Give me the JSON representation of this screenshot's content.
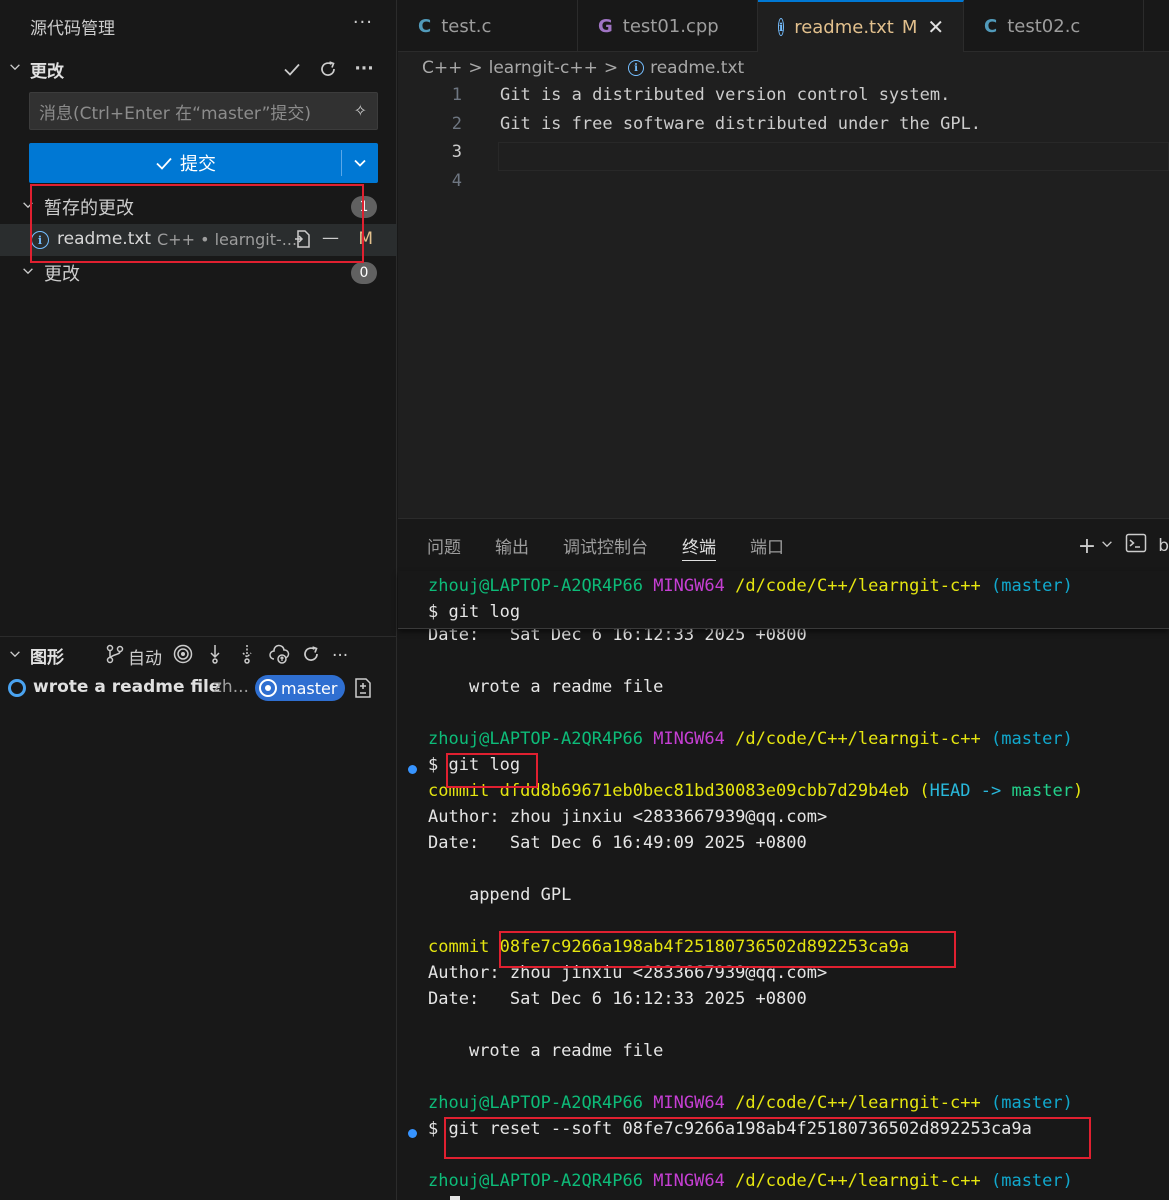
{
  "sidebar": {
    "title": "源代码管理",
    "more": "···",
    "changes_section": "更改",
    "message_placeholder": "消息(Ctrl+Enter 在“master”提交)",
    "commit_label": "提交",
    "staged_group": "暂存的更改",
    "staged_count": "1",
    "staged_file": {
      "name": "readme.txt",
      "path": "C++ • learngit-...",
      "status": "M"
    },
    "changes_group": "更改",
    "changes_count": "0",
    "graph_section": "图形",
    "graph_auto": "自动",
    "graph_item": {
      "message": "wrote a readme file",
      "author": "zh...",
      "branch": "master"
    }
  },
  "tabs": [
    {
      "icon": "C",
      "label": "test.c"
    },
    {
      "icon": "G",
      "label": "test01.cpp"
    },
    {
      "icon": "i",
      "label": "readme.txt",
      "modified": "M"
    },
    {
      "icon": "C",
      "label": "test02.c"
    }
  ],
  "breadcrumb": {
    "part1": "C++",
    "part2": "learngit-c++",
    "part3": "readme.txt",
    "sep": ">"
  },
  "editor_lines": [
    {
      "num": "1",
      "text": "Git is a distributed version control system."
    },
    {
      "num": "2",
      "text": "Git is free software distributed under the GPL."
    },
    {
      "num": "3",
      "text": ""
    },
    {
      "num": "4",
      "text": ""
    }
  ],
  "panel_tabs": [
    "问题",
    "输出",
    "调试控制台",
    "终端",
    "端口"
  ],
  "panel_right": {
    "plus": "+",
    "chev": "⌄",
    "b": "b"
  },
  "terminal": {
    "prompt_user": "zhouj@LAPTOP-A2QR4P66",
    "prompt_sys": "MINGW64",
    "prompt_path": "/d/code/C++/learngit-c++",
    "prompt_branch": "(master)",
    "dollar": "$",
    "cmd_log": "git log",
    "date_label": "Date:",
    "date1": "Sat Dec 6 16:12:33 2025 +0800",
    "msg1": "wrote a readme file",
    "commit_label": "commit",
    "hash1": "dfdd8b69671eb0bec81bd30083e09cbb7d29b4eb",
    "head": "(HEAD -> master)",
    "head_open": "(",
    "head_h": "HEAD",
    "head_arrow": "->",
    "head_master": "master",
    "head_close": ")",
    "author_label": "Author:",
    "author": "zhou jinxiu <2833667939@qq.com>",
    "date2": "Sat Dec 6 16:49:09 2025 +0800",
    "msg2": "append GPL",
    "hash2": "08fe7c9266a198ab4f25180736502d892253ca9a",
    "cmd_reset": "git reset --soft 08fe7c9266a198ab4f25180736502d892253ca9a"
  },
  "colors": {
    "accent": "#0078d4",
    "highlight": "#e02030"
  }
}
